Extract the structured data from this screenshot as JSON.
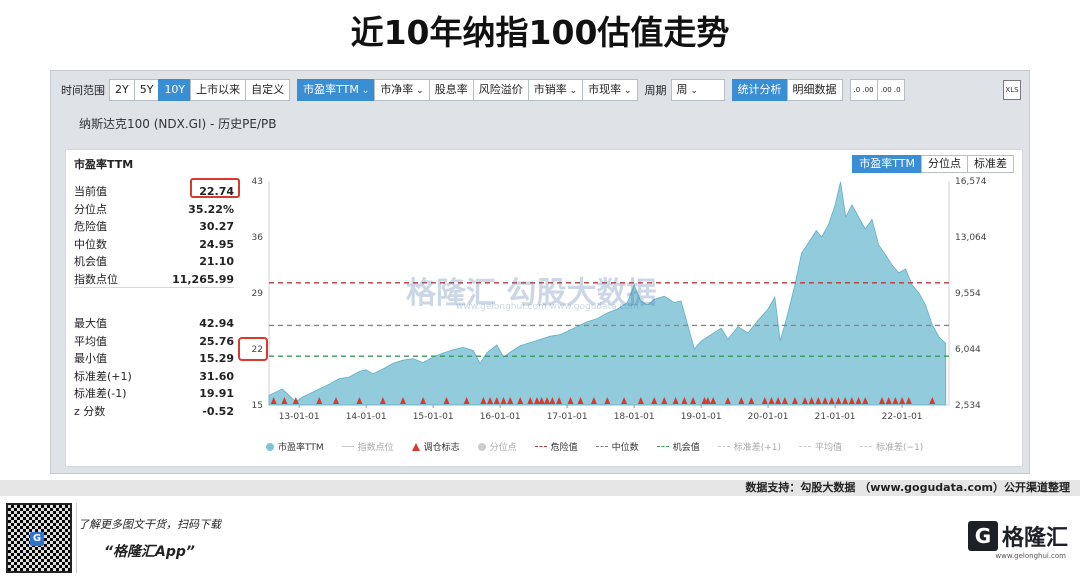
{
  "page_title": "近10年纳指100估值走势",
  "toolbar": {
    "range_label": "时间范围",
    "range_buttons": [
      "2Y",
      "5Y",
      "10Y",
      "上市以来",
      "自定义"
    ],
    "active_range": "10Y",
    "metric_buttons": [
      "市盈率TTM",
      "市净率",
      "股息率",
      "风险溢价",
      "市销率",
      "市现率"
    ],
    "period_label": "周期",
    "period_value": "周",
    "view_buttons": [
      "统计分析",
      "明细数据"
    ],
    "decimal_buttons": [
      ".0\n.00",
      ".00\n.0"
    ],
    "excel_label": "XLS"
  },
  "subtitle": "纳斯达克100 (NDX.GI) - 历史PE/PB",
  "stats": {
    "title": "市盈率TTM",
    "rows1": [
      {
        "label": "当前值",
        "value": "22.74"
      },
      {
        "label": "分位点",
        "value": "35.22%"
      },
      {
        "label": "危险值",
        "value": "30.27"
      },
      {
        "label": "中位数",
        "value": "24.95"
      },
      {
        "label": "机会值",
        "value": "21.10"
      },
      {
        "label": "指数点位",
        "value": "11,265.99"
      }
    ],
    "rows2": [
      {
        "label": "最大值",
        "value": "42.94"
      },
      {
        "label": "平均值",
        "value": "25.76"
      },
      {
        "label": "最小值",
        "value": "15.29"
      },
      {
        "label": "标准差(+1)",
        "value": "31.60"
      },
      {
        "label": "标准差(-1)",
        "value": "19.91"
      },
      {
        "label": "z 分数",
        "value": "-0.52"
      }
    ]
  },
  "chart_tabs": [
    "市盈率TTM",
    "分位点",
    "标准差"
  ],
  "watermark": "格隆汇   勾股大数据",
  "watermark_sub": "www.gelonghui.com    www.gogudata.com",
  "legend": [
    {
      "label": "市盈率TTM",
      "marker": "dot",
      "color": "#7fc3d6",
      "dim": false
    },
    {
      "label": "指数点位",
      "marker": "line",
      "color": "#cccccc",
      "dim": true
    },
    {
      "label": "调仓标志",
      "marker": "triangle",
      "color": "#d83a2e",
      "dim": false
    },
    {
      "label": "分位点",
      "marker": "dot",
      "color": "#cccccc",
      "dim": true
    },
    {
      "label": "危险值",
      "marker": "dash",
      "color": "#b83a3a",
      "dim": false
    },
    {
      "label": "中位数",
      "marker": "dash",
      "color": "#888888",
      "dim": false
    },
    {
      "label": "机会值",
      "marker": "dash",
      "color": "#3a9a5a",
      "dim": false
    },
    {
      "label": "标准差(+1)",
      "marker": "dash",
      "color": "#cccccc",
      "dim": true
    },
    {
      "label": "平均值",
      "marker": "dash",
      "color": "#cccccc",
      "dim": true
    },
    {
      "label": "标准差(−1)",
      "marker": "dash",
      "color": "#cccccc",
      "dim": true
    }
  ],
  "chart_data": {
    "type": "area",
    "ylim": [
      15,
      43
    ],
    "yticks": [
      15,
      22,
      29,
      36,
      43
    ],
    "y2ticks": [
      "2,534",
      "6,044",
      "9,554",
      "13,064",
      "16,574"
    ],
    "xlim": [
      2012.55,
      2022.7
    ],
    "xticks": [
      {
        "label": "13-01-01",
        "x": 2013.0
      },
      {
        "label": "14-01-01",
        "x": 2014.0
      },
      {
        "label": "15-01-01",
        "x": 2015.0
      },
      {
        "label": "16-01-01",
        "x": 2016.0
      },
      {
        "label": "17-01-01",
        "x": 2017.0
      },
      {
        "label": "18-01-01",
        "x": 2018.0
      },
      {
        "label": "19-01-01",
        "x": 2019.0
      },
      {
        "label": "20-01-01",
        "x": 2020.0
      },
      {
        "label": "21-01-01",
        "x": 2021.0
      },
      {
        "label": "22-01-01",
        "x": 2022.0
      }
    ],
    "reference_lines": [
      {
        "name": "危险值",
        "value": 30.27,
        "color": "#b83a3a"
      },
      {
        "name": "中位数",
        "value": 24.95,
        "color": "#888888"
      },
      {
        "name": "机会值",
        "value": 21.1,
        "color": "#3a9a5a"
      }
    ],
    "series": [
      {
        "name": "市盈率TTM",
        "color": "#7fc3d6",
        "points": [
          [
            2012.55,
            16.2
          ],
          [
            2012.65,
            16.6
          ],
          [
            2012.75,
            17.0
          ],
          [
            2012.85,
            16.2
          ],
          [
            2012.95,
            15.4
          ],
          [
            2013.05,
            16.0
          ],
          [
            2013.15,
            16.4
          ],
          [
            2013.3,
            17.0
          ],
          [
            2013.45,
            17.6
          ],
          [
            2013.6,
            18.3
          ],
          [
            2013.75,
            18.5
          ],
          [
            2013.9,
            19.2
          ],
          [
            2014.0,
            19.4
          ],
          [
            2014.1,
            18.9
          ],
          [
            2014.25,
            19.5
          ],
          [
            2014.4,
            20.2
          ],
          [
            2014.55,
            20.6
          ],
          [
            2014.7,
            20.8
          ],
          [
            2014.85,
            20.3
          ],
          [
            2015.0,
            21.0
          ],
          [
            2015.15,
            21.5
          ],
          [
            2015.3,
            21.9
          ],
          [
            2015.45,
            22.2
          ],
          [
            2015.6,
            21.8
          ],
          [
            2015.7,
            20.2
          ],
          [
            2015.8,
            21.5
          ],
          [
            2015.95,
            22.5
          ],
          [
            2016.05,
            21.0
          ],
          [
            2016.15,
            21.6
          ],
          [
            2016.3,
            22.4
          ],
          [
            2016.45,
            22.8
          ],
          [
            2016.6,
            23.2
          ],
          [
            2016.75,
            23.6
          ],
          [
            2016.9,
            23.8
          ],
          [
            2017.0,
            24.2
          ],
          [
            2017.15,
            24.8
          ],
          [
            2017.3,
            25.4
          ],
          [
            2017.45,
            25.8
          ],
          [
            2017.6,
            26.5
          ],
          [
            2017.75,
            27.0
          ],
          [
            2017.9,
            27.8
          ],
          [
            2018.0,
            30.0
          ],
          [
            2018.1,
            28.0
          ],
          [
            2018.2,
            27.5
          ],
          [
            2018.3,
            28.2
          ],
          [
            2018.45,
            28.6
          ],
          [
            2018.6,
            27.8
          ],
          [
            2018.7,
            28.0
          ],
          [
            2018.8,
            25.0
          ],
          [
            2018.9,
            22.0
          ],
          [
            2019.0,
            23.0
          ],
          [
            2019.15,
            23.8
          ],
          [
            2019.3,
            24.6
          ],
          [
            2019.4,
            23.2
          ],
          [
            2019.55,
            24.8
          ],
          [
            2019.7,
            24.0
          ],
          [
            2019.85,
            25.6
          ],
          [
            2020.0,
            27.0
          ],
          [
            2020.1,
            28.5
          ],
          [
            2020.18,
            23.0
          ],
          [
            2020.28,
            26.0
          ],
          [
            2020.4,
            30.0
          ],
          [
            2020.5,
            34.0
          ],
          [
            2020.62,
            35.5
          ],
          [
            2020.72,
            36.8
          ],
          [
            2020.8,
            36.0
          ],
          [
            2020.9,
            37.5
          ],
          [
            2021.0,
            40.0
          ],
          [
            2021.08,
            42.9
          ],
          [
            2021.16,
            38.5
          ],
          [
            2021.25,
            40.0
          ],
          [
            2021.35,
            38.5
          ],
          [
            2021.45,
            37.0
          ],
          [
            2021.55,
            38.2
          ],
          [
            2021.65,
            35.0
          ],
          [
            2021.75,
            33.8
          ],
          [
            2021.85,
            32.5
          ],
          [
            2021.95,
            31.5
          ],
          [
            2022.05,
            32.0
          ],
          [
            2022.15,
            30.0
          ],
          [
            2022.25,
            29.0
          ],
          [
            2022.35,
            27.5
          ],
          [
            2022.45,
            25.0
          ],
          [
            2022.55,
            23.5
          ],
          [
            2022.65,
            22.7
          ]
        ]
      }
    ],
    "rebalance_markers": [
      2012.62,
      2012.78,
      2012.95,
      2013.3,
      2013.55,
      2013.9,
      2014.25,
      2014.55,
      2014.85,
      2015.2,
      2015.5,
      2015.75,
      2015.85,
      2015.95,
      2016.05,
      2016.15,
      2016.3,
      2016.45,
      2016.55,
      2016.62,
      2016.7,
      2016.78,
      2016.88,
      2017.05,
      2017.2,
      2017.4,
      2017.6,
      2017.85,
      2018.1,
      2018.3,
      2018.45,
      2018.62,
      2018.75,
      2018.88,
      2019.05,
      2019.1,
      2019.18,
      2019.4,
      2019.6,
      2019.75,
      2019.95,
      2020.05,
      2020.15,
      2020.25,
      2020.4,
      2020.55,
      2020.65,
      2020.75,
      2020.85,
      2020.95,
      2021.05,
      2021.15,
      2021.25,
      2021.35,
      2021.45,
      2021.7,
      2021.8,
      2021.9,
      2022.0,
      2022.1,
      2022.45
    ]
  },
  "source_text": "数据支持：勾股大数据 （www.gogudata.com）公开渠道整理",
  "footer": {
    "line1": "了解更多图文干货，扫码下载",
    "line2": "“格隆汇App”",
    "logo_text": "格隆汇",
    "logo_sub": "www.gelonghui.com"
  }
}
